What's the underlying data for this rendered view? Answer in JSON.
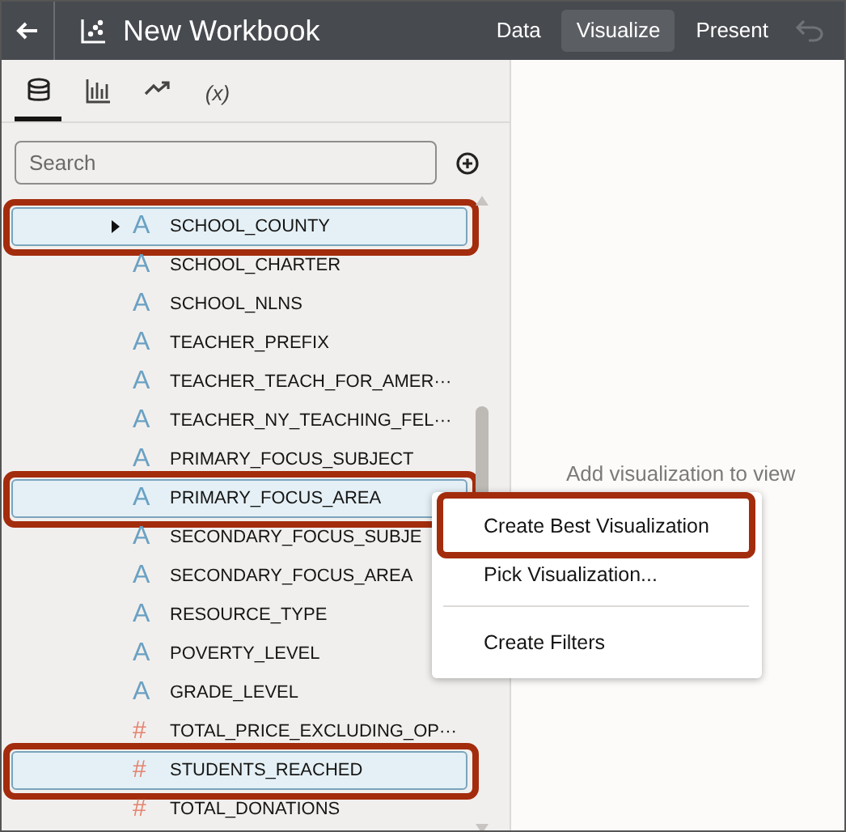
{
  "header": {
    "title": "New Workbook",
    "nav": [
      {
        "label": "Data",
        "selected": false
      },
      {
        "label": "Visualize",
        "selected": true
      },
      {
        "label": "Present",
        "selected": false
      }
    ]
  },
  "panel_tabs": [
    {
      "kind": "data",
      "selected": true
    },
    {
      "kind": "visualizations",
      "selected": false
    },
    {
      "kind": "analytics",
      "selected": false
    },
    {
      "kind": "calculations",
      "label": "(x)",
      "selected": false
    }
  ],
  "search": {
    "placeholder": "Search"
  },
  "fields": [
    {
      "name": "SCHOOL_COUNTY",
      "icon": "A",
      "kind": "attribute",
      "selected": true,
      "highlighted": true,
      "expander": true
    },
    {
      "name": "SCHOOL_CHARTER",
      "icon": "A",
      "kind": "attribute",
      "selected": false,
      "highlighted": false
    },
    {
      "name": "SCHOOL_NLNS",
      "icon": "A",
      "kind": "attribute",
      "selected": false,
      "highlighted": false
    },
    {
      "name": "TEACHER_PREFIX",
      "icon": "A",
      "kind": "attribute",
      "selected": false,
      "highlighted": false
    },
    {
      "name": "TEACHER_TEACH_FOR_AMER···",
      "icon": "A",
      "kind": "attribute",
      "selected": false,
      "highlighted": false
    },
    {
      "name": "TEACHER_NY_TEACHING_FEL···",
      "icon": "A",
      "kind": "attribute",
      "selected": false,
      "highlighted": false
    },
    {
      "name": "PRIMARY_FOCUS_SUBJECT",
      "icon": "A",
      "kind": "attribute",
      "selected": false,
      "highlighted": false
    },
    {
      "name": "PRIMARY_FOCUS_AREA",
      "icon": "A",
      "kind": "attribute",
      "selected": true,
      "highlighted": true
    },
    {
      "name": "SECONDARY_FOCUS_SUBJE",
      "icon": "A",
      "kind": "attribute",
      "selected": false,
      "highlighted": false
    },
    {
      "name": "SECONDARY_FOCUS_AREA",
      "icon": "A",
      "kind": "attribute",
      "selected": false,
      "highlighted": false
    },
    {
      "name": "RESOURCE_TYPE",
      "icon": "A",
      "kind": "attribute",
      "selected": false,
      "highlighted": false
    },
    {
      "name": "POVERTY_LEVEL",
      "icon": "A",
      "kind": "attribute",
      "selected": false,
      "highlighted": false
    },
    {
      "name": "GRADE_LEVEL",
      "icon": "A",
      "kind": "attribute",
      "selected": false,
      "highlighted": false
    },
    {
      "name": "TOTAL_PRICE_EXCLUDING_OP···",
      "icon": "#",
      "kind": "measure",
      "selected": false,
      "highlighted": false
    },
    {
      "name": "STUDENTS_REACHED",
      "icon": "#",
      "kind": "measure",
      "selected": true,
      "highlighted": true
    },
    {
      "name": "TOTAL_DONATIONS",
      "icon": "#",
      "kind": "measure",
      "selected": false,
      "highlighted": false
    }
  ],
  "canvas": {
    "hint": "Add visualization to view"
  },
  "context_menu": [
    {
      "label": "Create Best Visualization",
      "highlighted": true,
      "divider_before": false
    },
    {
      "label": "Pick Visualization...",
      "highlighted": false,
      "divider_before": false
    },
    {
      "label": "Create Filters",
      "highlighted": false,
      "divider_before": true
    }
  ]
}
